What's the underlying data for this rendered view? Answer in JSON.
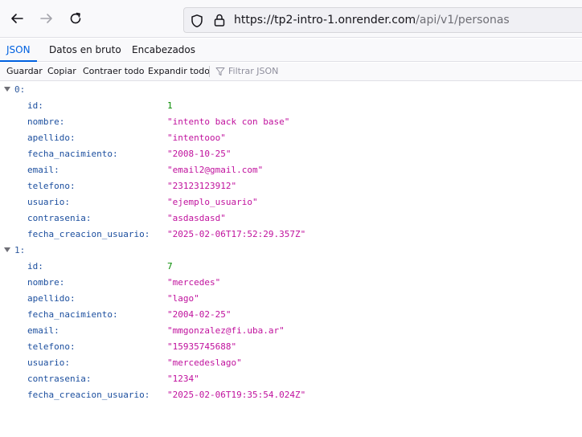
{
  "browser": {
    "url_host": "https://tp2-intro-1.onrender.com",
    "url_path": "/api/v1/personas"
  },
  "tabs": [
    {
      "label": "JSON"
    },
    {
      "label": "Datos en bruto"
    },
    {
      "label": "Encabezados"
    }
  ],
  "toolbar": {
    "save_label": "Guardar",
    "copy_label": "Copiar",
    "collapse_label": "Contraer todo",
    "expand_label": "Expandir todo",
    "filter_placeholder": "Filtrar JSON"
  },
  "records": [
    {
      "index": "0:",
      "fields": [
        {
          "key": "id:",
          "value": "1",
          "type": "number"
        },
        {
          "key": "nombre:",
          "value": "\"intento back con base\"",
          "type": "string"
        },
        {
          "key": "apellido:",
          "value": "\"intentooo\"",
          "type": "string"
        },
        {
          "key": "fecha_nacimiento:",
          "value": "\"2008-10-25\"",
          "type": "string"
        },
        {
          "key": "email:",
          "value": "\"email2@gmail.com\"",
          "type": "string"
        },
        {
          "key": "telefono:",
          "value": "\"23123123912\"",
          "type": "string"
        },
        {
          "key": "usuario:",
          "value": "\"ejemplo_usuario\"",
          "type": "string"
        },
        {
          "key": "contrasenia:",
          "value": "\"asdasdasd\"",
          "type": "string"
        },
        {
          "key": "fecha_creacion_usuario:",
          "value": "\"2025-02-06T17:52:29.357Z\"",
          "type": "string"
        }
      ]
    },
    {
      "index": "1:",
      "fields": [
        {
          "key": "id:",
          "value": "7",
          "type": "number"
        },
        {
          "key": "nombre:",
          "value": "\"mercedes\"",
          "type": "string"
        },
        {
          "key": "apellido:",
          "value": "\"lago\"",
          "type": "string"
        },
        {
          "key": "fecha_nacimiento:",
          "value": "\"2004-02-25\"",
          "type": "string"
        },
        {
          "key": "email:",
          "value": "\"mmgonzalez@fi.uba.ar\"",
          "type": "string"
        },
        {
          "key": "telefono:",
          "value": "\"15935745688\"",
          "type": "string"
        },
        {
          "key": "usuario:",
          "value": "\"mercedeslago\"",
          "type": "string"
        },
        {
          "key": "contrasenia:",
          "value": "\"1234\"",
          "type": "string"
        },
        {
          "key": "fecha_creacion_usuario:",
          "value": "\"2025-02-06T19:35:54.024Z\"",
          "type": "string"
        }
      ]
    }
  ],
  "colors": {
    "accent": "#0061e0",
    "key": "#1b4e9e",
    "string": "#c0119d",
    "number": "#058b00"
  },
  "icons": [
    "back-arrow-icon",
    "forward-arrow-icon",
    "reload-icon",
    "tracking-shield-icon",
    "lock-icon",
    "filter-icon",
    "expand-twisty-icon"
  ]
}
